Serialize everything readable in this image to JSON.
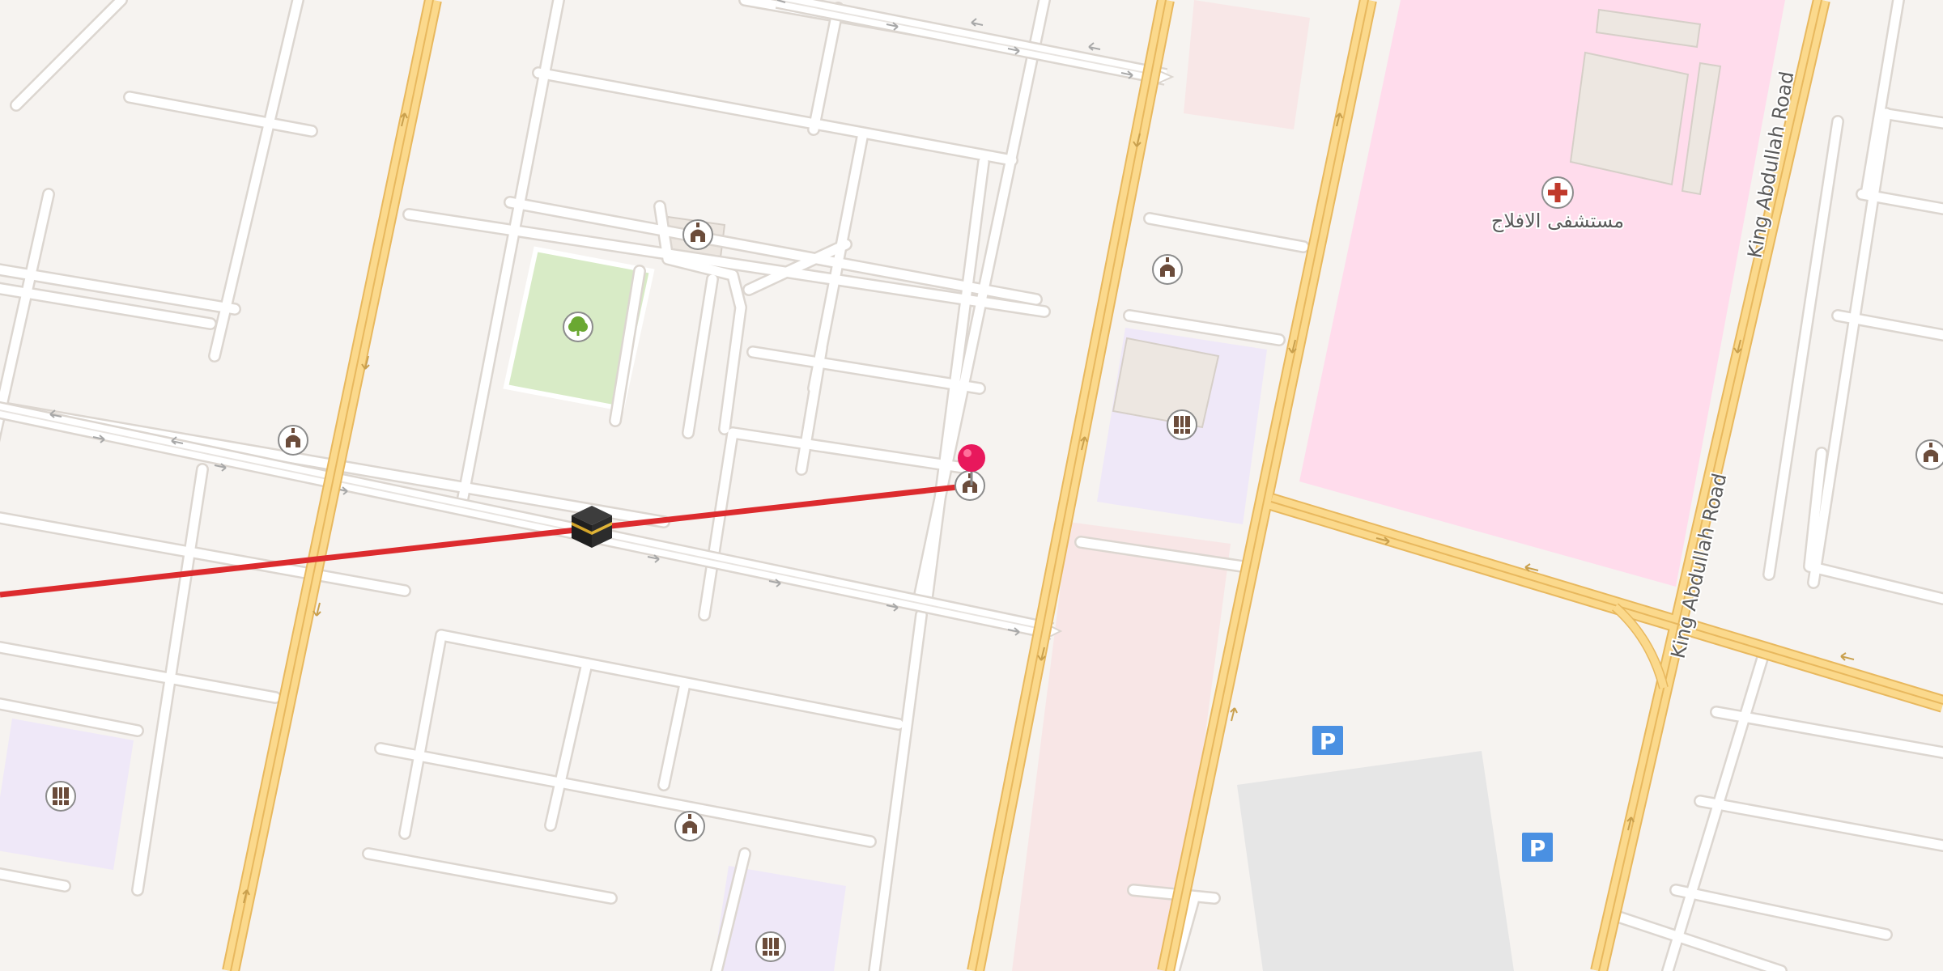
{
  "labels": {
    "hospital_name": "مستشفى الافلاج",
    "road_east_north": "King Abdullah Road",
    "road_east_south": "King Abdullah Road",
    "parking_1": "P",
    "parking_2": "P"
  },
  "colors": {
    "background": "#f6f3f0",
    "major_road": "#fbd98c",
    "major_road_edge": "#e8b85e",
    "minor_road": "#ffffff",
    "block_edge": "#e2ddd8",
    "park": "#d8ebc6",
    "hospital_area": "#ffdcec",
    "education_area": "#efe8f8",
    "commercial_area": "#f8e6e6",
    "parking_lot": "#e6e6e6",
    "route_line": "#dc2b2e",
    "pin": "#e8185c",
    "parking_sign": "#4a90e2",
    "hospital_cross": "#c0392b"
  },
  "icons": {
    "qibla_target": "kaaba-icon",
    "pin": "location-pin-icon",
    "mosque": "mosque-icon",
    "school": "school-icon",
    "park": "tree-icon",
    "hospital": "hospital-cross-icon",
    "parking": "parking-icon"
  }
}
